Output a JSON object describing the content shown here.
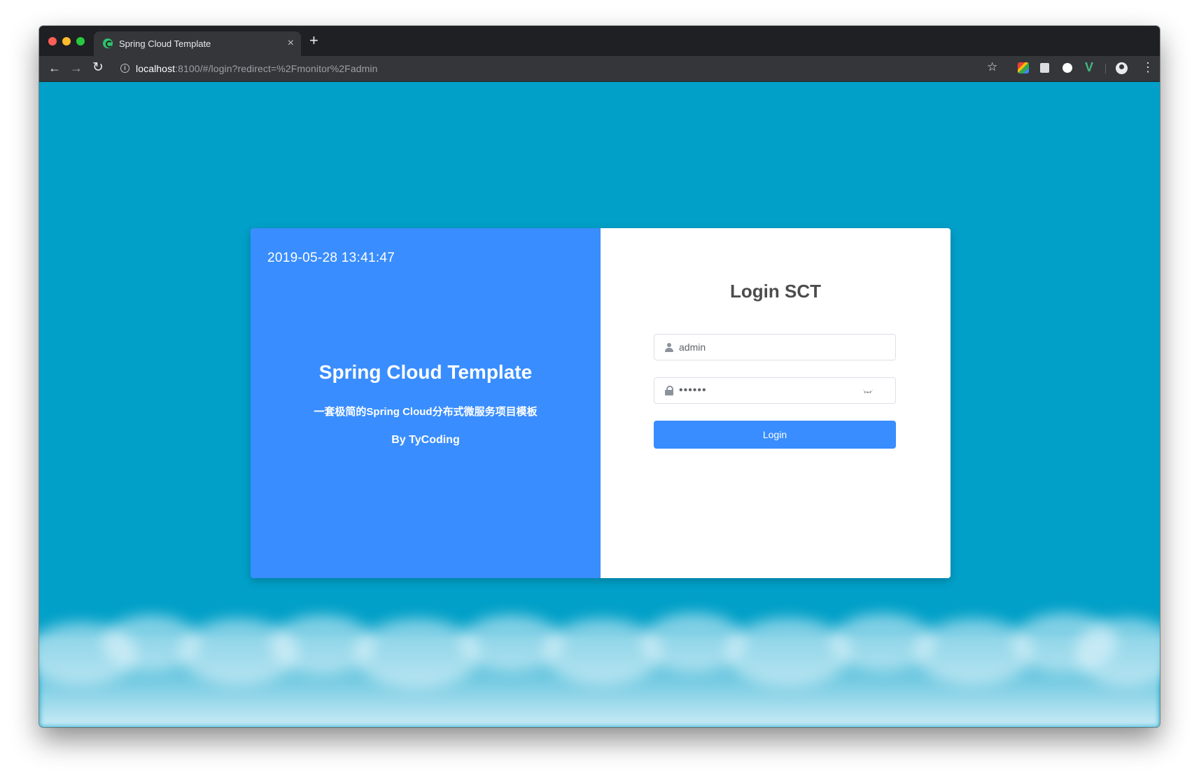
{
  "browser": {
    "tab_title": "Spring Cloud Template",
    "tab_close": "×",
    "new_tab": "+",
    "url_host": "localhost",
    "url_rest": ":8100/#/login?redirect=%2Fmonitor%2Fadmin",
    "icons": [
      "back-arrow-icon",
      "forward-arrow-icon",
      "reload-icon",
      "info-icon",
      "star-icon",
      "profile-icon",
      "menu-icon"
    ]
  },
  "page": {
    "background_color": "#00a0c8",
    "accent_color": "#398dfe",
    "left_panel": {
      "datetime": "2019-05-28 13:41:47",
      "title": "Spring Cloud Template",
      "subtitle": "一套极简的Spring Cloud分布式微服务项目模板",
      "author": "By TyCoding"
    },
    "login": {
      "title": "Login SCT",
      "username_value": "admin",
      "password_value": "123456",
      "button_label": "Login"
    }
  }
}
